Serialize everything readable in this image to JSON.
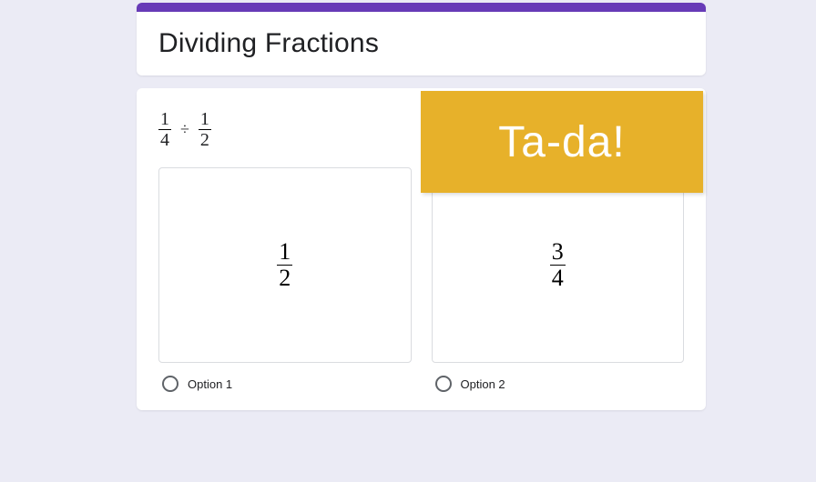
{
  "header": {
    "title": "Dividing Fractions"
  },
  "question": {
    "frac1_num": "1",
    "frac1_den": "4",
    "operator": "÷",
    "frac2_num": "1",
    "frac2_den": "2"
  },
  "options": [
    {
      "num": "1",
      "den": "2",
      "label": "Option 1"
    },
    {
      "num": "3",
      "den": "4",
      "label": "Option 2"
    }
  ],
  "overlay": {
    "text": "Ta-da!"
  }
}
